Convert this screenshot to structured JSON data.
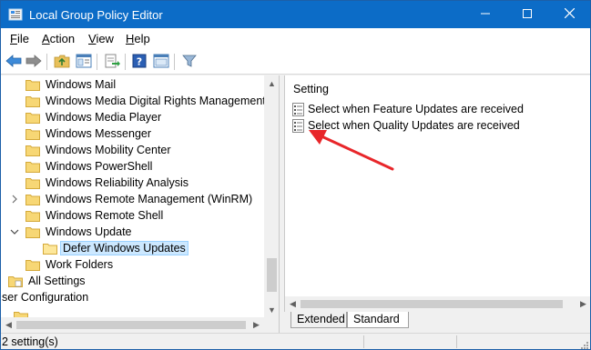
{
  "window": {
    "title": "Local Group Policy Editor",
    "accent_color": "#0c6cc7",
    "controls": {
      "minimize_icon": "minimize-icon",
      "maximize_icon": "maximize-icon",
      "close_icon": "close-icon"
    }
  },
  "menu": {
    "items": [
      {
        "label": "File",
        "mnemonic": "F",
        "rest": "ile"
      },
      {
        "label": "Action",
        "mnemonic": "A",
        "rest": "ction"
      },
      {
        "label": "View",
        "mnemonic": "V",
        "rest": "iew"
      },
      {
        "label": "Help",
        "mnemonic": "H",
        "rest": "elp"
      }
    ]
  },
  "toolbar": {
    "buttons": [
      "back-icon",
      "forward-icon",
      "up-folder-icon",
      "show-hide-tree-icon",
      "export-list-icon",
      "help-icon",
      "properties-icon",
      "filter-icon"
    ]
  },
  "tree": {
    "items": [
      {
        "label": "Windows Mail",
        "expander": ""
      },
      {
        "label": "Windows Media Digital Rights Management",
        "expander": ""
      },
      {
        "label": "Windows Media Player",
        "expander": ""
      },
      {
        "label": "Windows Messenger",
        "expander": ""
      },
      {
        "label": "Windows Mobility Center",
        "expander": ""
      },
      {
        "label": "Windows PowerShell",
        "expander": ""
      },
      {
        "label": "Windows Reliability Analysis",
        "expander": ""
      },
      {
        "label": "Windows Remote Management (WinRM)",
        "expander": "collapsed"
      },
      {
        "label": "Windows Remote Shell",
        "expander": ""
      },
      {
        "label": "Windows Update",
        "expander": "expanded"
      },
      {
        "label": "Defer Windows Updates",
        "expander": "",
        "selected": true
      },
      {
        "label": "Work Folders",
        "expander": ""
      },
      {
        "label": "All Settings",
        "expander": ""
      },
      {
        "label": "ser Configuration",
        "expander": ""
      }
    ]
  },
  "settings_pane": {
    "column_header": "Setting",
    "rows": [
      {
        "label": "Select when Feature Updates are received"
      },
      {
        "label": "Select when Quality Updates are received"
      }
    ]
  },
  "tabs": [
    {
      "label": "Extended",
      "active": false
    },
    {
      "label": "Standard",
      "active": true
    }
  ],
  "status": {
    "text": "2 setting(s)"
  },
  "annotation": {
    "color": "#e8262a"
  }
}
